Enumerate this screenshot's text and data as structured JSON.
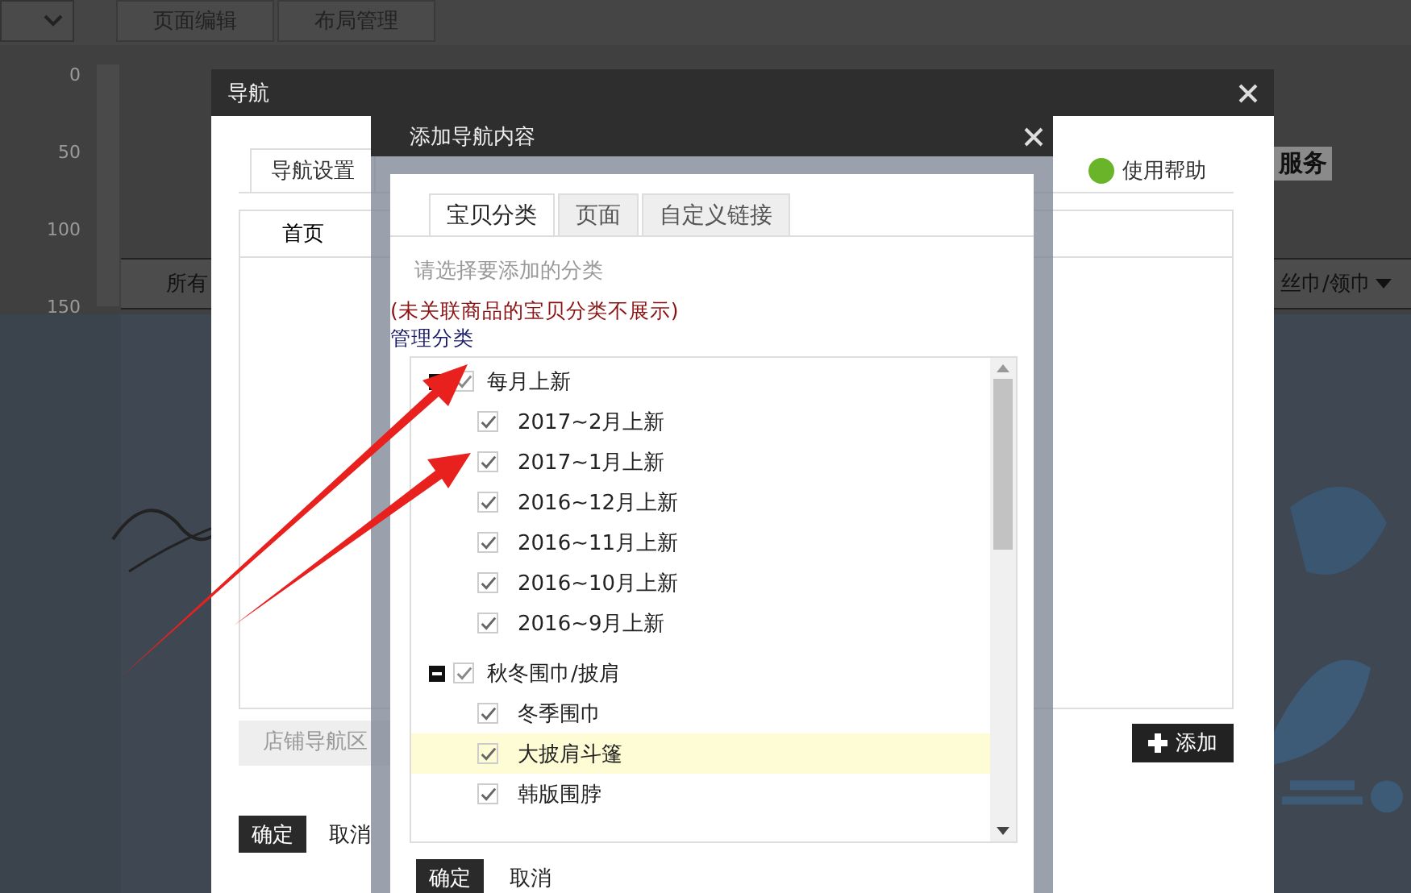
{
  "background_page": {
    "toolbar_buttons": [
      "页面编辑",
      "布局管理"
    ],
    "ruler_marks": [
      "0",
      "50",
      "100",
      "150"
    ],
    "nav_left": "所有",
    "service_text": "服务",
    "nav_right": "丝巾/领巾"
  },
  "nav_dialog": {
    "title": "导航",
    "tabs": [
      {
        "label": "导航设置",
        "selected": true
      }
    ],
    "help": "使用帮助",
    "table_header": "首页",
    "hint": "店铺导航区",
    "add_button": "添加",
    "buttons": [
      "确定",
      "取消"
    ]
  },
  "add_dialog": {
    "title": "添加导航内容",
    "tabs": [
      {
        "label": "宝贝分类",
        "selected": true
      },
      {
        "label": "页面",
        "selected": false
      },
      {
        "label": "自定义链接",
        "selected": false
      }
    ],
    "prompt": "请选择要添加的分类",
    "note": "(未关联商品的宝贝分类不展示)",
    "manage_label": "管理分类",
    "tree": [
      {
        "label": "每月上新",
        "checked": true,
        "expanded": true,
        "children": [
          {
            "label": "2017~2月上新",
            "checked": true,
            "selected": false
          },
          {
            "label": "2017~1月上新",
            "checked": true,
            "selected": false
          },
          {
            "label": "2016~12月上新",
            "checked": true,
            "selected": false
          },
          {
            "label": "2016~11月上新",
            "checked": true,
            "selected": false
          },
          {
            "label": "2016~10月上新",
            "checked": true,
            "selected": false
          },
          {
            "label": "2016~9月上新",
            "checked": true,
            "selected": false
          }
        ]
      },
      {
        "label": "秋冬围巾/披肩",
        "checked": true,
        "expanded": true,
        "children": [
          {
            "label": "冬季围巾",
            "checked": true,
            "selected": false
          },
          {
            "label": "大披肩斗篷",
            "checked": true,
            "selected": true
          },
          {
            "label": "韩版围脖",
            "checked": true,
            "selected": false
          }
        ]
      }
    ],
    "buttons": [
      "确定",
      "取消"
    ]
  }
}
